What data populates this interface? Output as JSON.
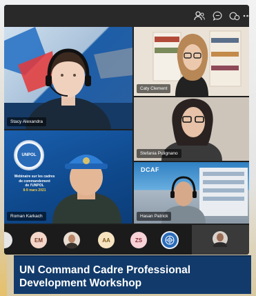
{
  "toolbar": {
    "icons": [
      "people-icon",
      "chat-icon",
      "reactions-icon",
      "more-icon"
    ]
  },
  "tiles": [
    {
      "name": "Stacy Alexandra"
    },
    {
      "name": "Caty Clement"
    },
    {
      "name": "Stefania Pulignano"
    },
    {
      "name": "Roman Karkach"
    },
    {
      "name": "Hasan Patrick"
    }
  ],
  "slide": {
    "logo_text": "UNPOL",
    "line1": "Webinaire sur les cadres",
    "line2": "de commandement",
    "line3": "de l'UNPOL",
    "line4": "8-9 mars 2021"
  },
  "dcaf_logo": "DCAF",
  "participants": [
    "EM",
    "AA",
    "ZS"
  ],
  "colors": {
    "em": "#f3d6c9",
    "aa": "#f6e3c0",
    "zs": "#f7d2d6",
    "caption_bg": "#123b6b"
  },
  "caption": {
    "line1": "UN Command Cadre Professional",
    "line2": "Development Workshop"
  }
}
